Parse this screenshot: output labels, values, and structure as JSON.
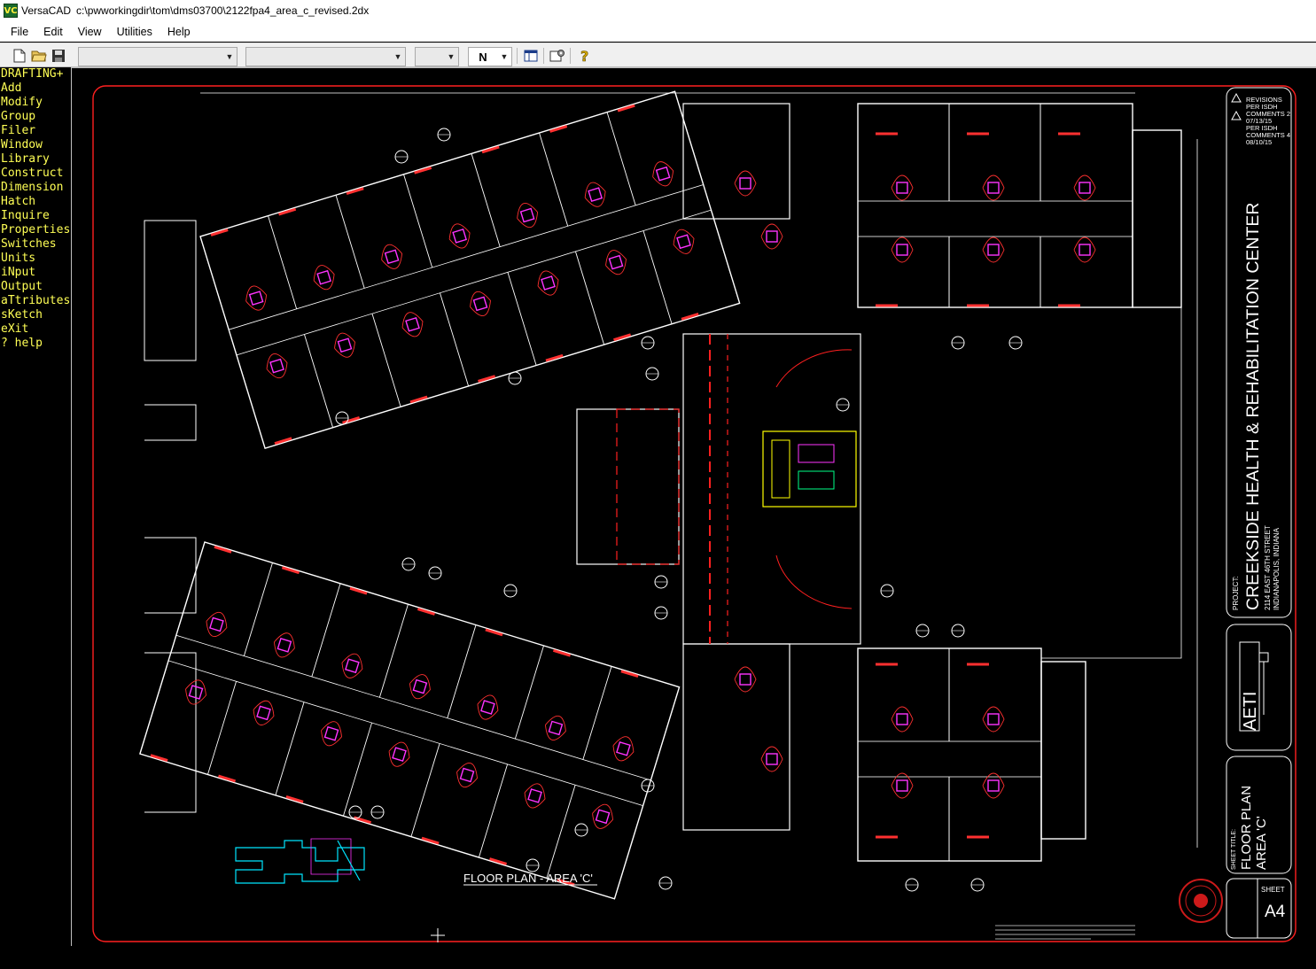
{
  "window": {
    "app_name": "VersaCAD",
    "file_path": "c:\\pwworkingdir\\tom\\dms03700\\2122fpa4_area_c_revised.2dx",
    "icon_label": "VC"
  },
  "menubar": {
    "items": [
      "File",
      "Edit",
      "View",
      "Utilities",
      "Help"
    ]
  },
  "toolbar": {
    "combo1_value": "",
    "combo2_value": "",
    "combo3_value": "",
    "layer_value": "N",
    "icons": [
      "new-file-icon",
      "open-folder-icon",
      "save-icon",
      "panel-icon",
      "settings-icon",
      "help-icon"
    ]
  },
  "side_menu": {
    "items": [
      "DRAFTING+",
      "Add",
      "Modify",
      "Group",
      "Filer",
      "Window",
      "Library",
      "Construct",
      "Dimension",
      "Hatch",
      "Inquire",
      "Properties",
      "Switches",
      "Units",
      "iNput",
      "Output",
      "aTtributes",
      "sKetch",
      "eXit",
      "? help"
    ]
  },
  "drawing": {
    "plan_title": "FLOOR PLAN - AREA 'C'",
    "project_label": "PROJECT:",
    "project_name": "CREEKSIDE HEALTH & REHABILITATION CENTER",
    "project_address_1": "2114 EAST 46TH STREET",
    "project_address_2": "INDIANAPOLIS, INDIANA",
    "firm_logo": "AETI",
    "sheet_title_label": "SHEET TITLE:",
    "sheet_title_1": "FLOOR PLAN",
    "sheet_title_2": "AREA 'C'",
    "sheet_label": "SHEET",
    "sheet_number": "A4",
    "revisions": [
      "REVISIONS",
      "PER ISDH",
      "COMMENTS 2",
      "07/13/15",
      "PER ISDH",
      "COMMENTS 4",
      "08/10/15"
    ],
    "colors": {
      "walls": "#ffffff",
      "border": "#ff2020",
      "fixtures": "#ff33ff",
      "doors": "#ff3030",
      "kitchen": "#ffff00",
      "key_plan": "#00e5ff",
      "frame": "#66d9ff"
    }
  }
}
